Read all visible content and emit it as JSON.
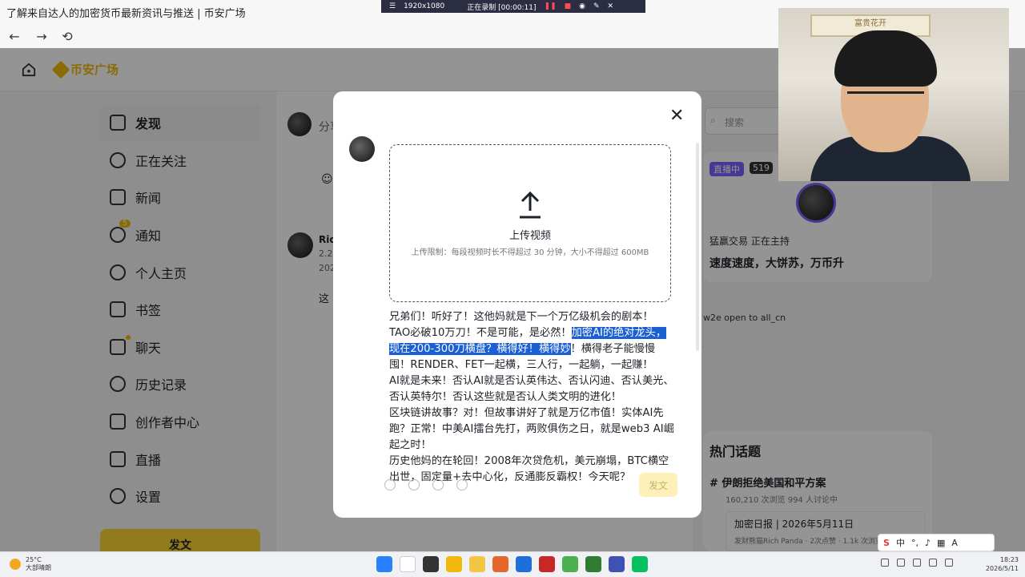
{
  "browser": {
    "title": "了解来自达人的加密货币最新资讯与推送 | 币安广场",
    "back": "←",
    "forward": "→",
    "reload": "⟲"
  },
  "recorder": {
    "resolution": "1920x1080",
    "status": "正在录制 [00:00:11]"
  },
  "site": {
    "brand": "币安广场"
  },
  "sidebar": {
    "items": [
      {
        "label": "发现",
        "icon": "discover-icon"
      },
      {
        "label": "正在关注",
        "icon": "following-icon"
      },
      {
        "label": "新闻",
        "icon": "news-icon"
      },
      {
        "label": "通知",
        "icon": "bell-icon"
      },
      {
        "label": "个人主页",
        "icon": "profile-icon"
      },
      {
        "label": "书签",
        "icon": "bookmark-icon"
      },
      {
        "label": "聊天",
        "icon": "chat-icon"
      },
      {
        "label": "历史记录",
        "icon": "history-icon"
      },
      {
        "label": "创作者中心",
        "icon": "creator-icon"
      },
      {
        "label": "直播",
        "icon": "live-icon"
      },
      {
        "label": "设置",
        "icon": "settings-icon"
      }
    ],
    "notify_badge": "5",
    "post_button": "发文"
  },
  "feed": {
    "composer_placeholder": "分享",
    "author_short": "Ric",
    "meta_1": "2.2",
    "meta_2": "202",
    "text_short": "这"
  },
  "right": {
    "search_placeholder": "搜索",
    "live_tag": "直播中",
    "live_count": "519",
    "host": "猛赢交易 正在主持",
    "slogan": "速度速度，大饼苏，万币升",
    "banner_alt": "w2e open to all_cn",
    "topics_title": "热门话题",
    "topic": "伊朗拒绝美国和平方案",
    "topic_meta": "160,210 次浏览   994 人讨论中",
    "sub_title": "加密日报 | 2026年5月11日",
    "sub_meta": "发财熊猫Rich Panda · 2次点赞 · 1.1k 次浏览"
  },
  "modal": {
    "upload_title": "上传视频",
    "upload_hint": "上传限制：每段视频时长不得超过 30 分钟，大小不得超过 600MB",
    "text_a": "兄弟们！听好了！这他妈就是下一个万亿级机会的剧本！",
    "text_b_pre": "TAO必破10万刀！不是可能，是必然！",
    "text_b_hl": "加密AI的绝对龙头，现在200-300刀横盘？横得好！横得妙",
    "text_b_post": "！横得老子能慢慢囤！RENDER、FET一起横，三人行，一起躺，一起赚！",
    "text_c": "AI就是未来！否认AI就是否认英伟达、否认闪迪、否认美光、否认英特尔！否认这些就是否认人类文明的进化！",
    "text_d": "区块链讲故事？对！但故事讲好了就是万亿市值！实体AI先跑？正常！中美AI擂台先打，两败俱伤之日，就是web3 AI崛起之时！",
    "text_e": "历史他妈的在轮回！2008年次贷危机，美元崩塌，BTC横空出世，固定量+去中心化，反通膨反霸权！今天呢？",
    "send": "发文",
    "close": "✕"
  },
  "webcam": {
    "frame_text": "富贵花开"
  },
  "taskbar": {
    "temp": "25°C",
    "weather": "大部晴朗",
    "ime_cn": "中",
    "time": "18:23",
    "date": "2026/5/11"
  }
}
